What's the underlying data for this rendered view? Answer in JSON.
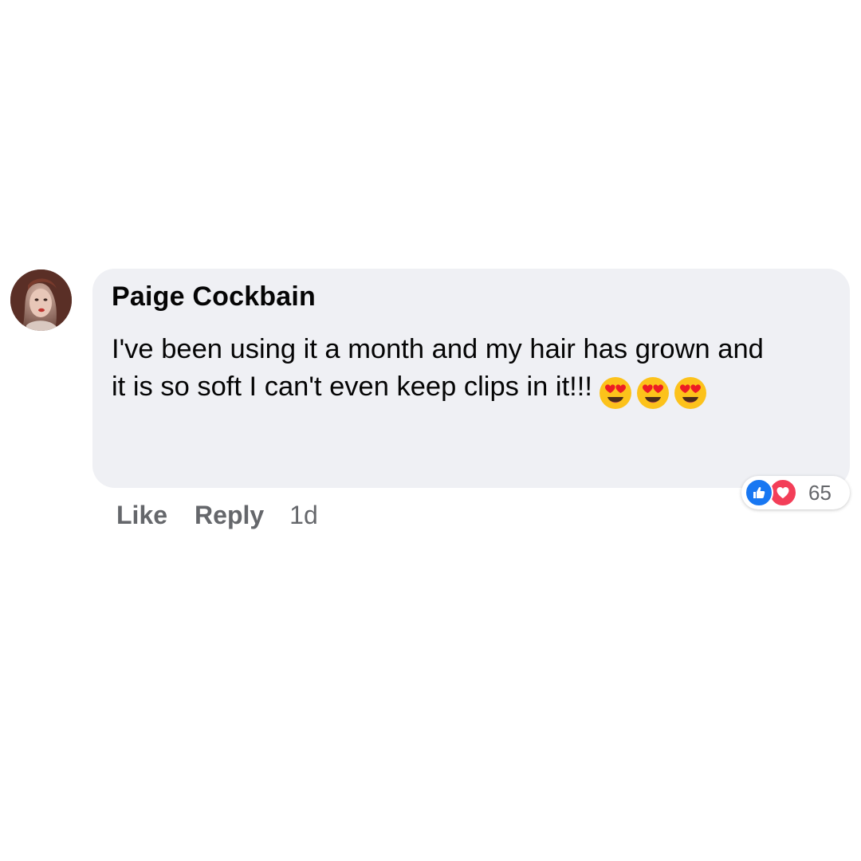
{
  "comment": {
    "author": "Paige Cockbain",
    "text": "I've been using it a month and my hair has grown and it is so soft I can't even keep clips in it!!!",
    "emojis": [
      "smiling-face-with-heart-eyes",
      "smiling-face-with-heart-eyes",
      "smiling-face-with-heart-eyes"
    ]
  },
  "actions": {
    "like_label": "Like",
    "reply_label": "Reply",
    "timestamp": "1d"
  },
  "reactions": {
    "types": [
      "like-icon",
      "love-icon"
    ],
    "count": "65"
  },
  "colors": {
    "bubble_background": "#eff0f4",
    "secondary_text": "#65676b",
    "like_blue": "#1877f2",
    "love_red": "#f33e58"
  }
}
